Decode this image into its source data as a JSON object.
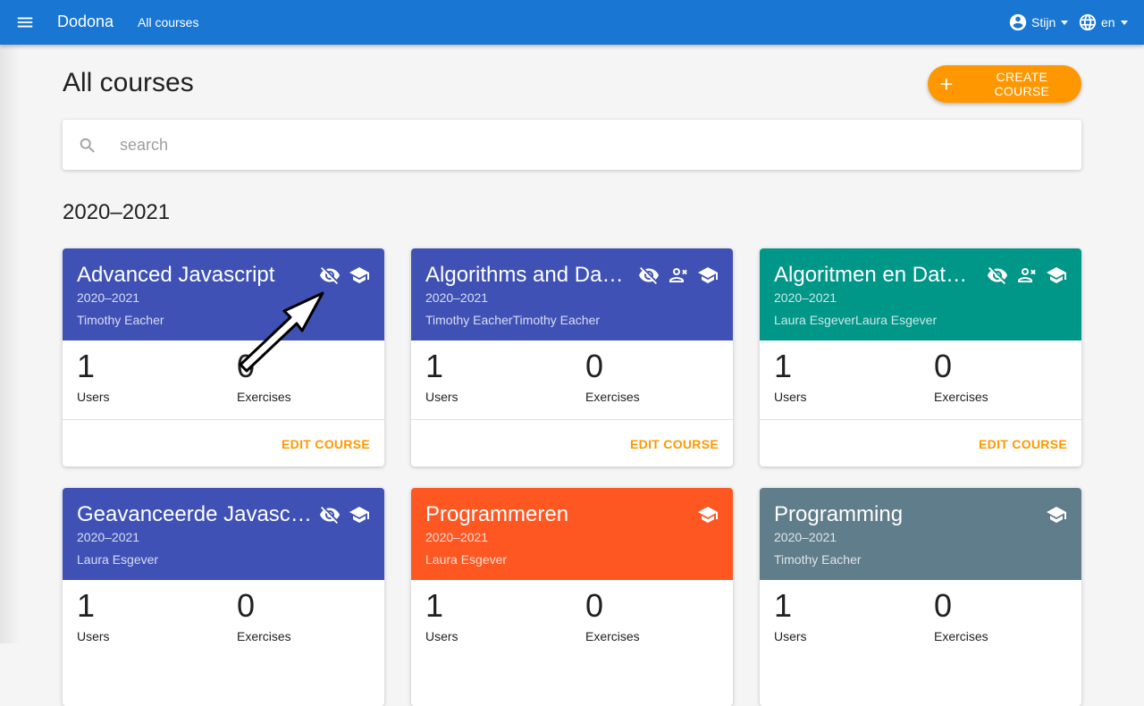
{
  "header": {
    "brand": "Dodona",
    "breadcrumb": "All courses",
    "user_name": "Stijn",
    "language": "en",
    "color": "#1976d2"
  },
  "page": {
    "title": "All courses",
    "create_button_label": "CREATE COURSE",
    "accent": "#ff9800"
  },
  "search": {
    "placeholder": "search",
    "value": ""
  },
  "year_group": {
    "heading": "2020–2021"
  },
  "courses": [
    {
      "title": "Advanced Javascript",
      "year": "2020–2021",
      "teacher": "Timothy Eacher",
      "color": "#3f51b5",
      "icons": [
        "visibility-off-icon",
        "school-icon"
      ],
      "users": "1",
      "users_label": "Users",
      "exercises": "0",
      "exercises_label": "Exercises",
      "action": "EDIT COURSE"
    },
    {
      "title": "Algorithms and Data …",
      "year": "2020–2021",
      "teacher": "Timothy EacherTimothy Eacher",
      "color": "#3f51b5",
      "icons": [
        "visibility-off-icon",
        "person-remove-icon",
        "school-icon"
      ],
      "users": "1",
      "users_label": "Users",
      "exercises": "0",
      "exercises_label": "Exercises",
      "action": "EDIT COURSE"
    },
    {
      "title": "Algoritmen en Datast…",
      "year": "2020–2021",
      "teacher": "Laura EsgeverLaura Esgever",
      "color": "#009688",
      "icons": [
        "visibility-off-icon",
        "person-remove-icon",
        "school-icon"
      ],
      "users": "1",
      "users_label": "Users",
      "exercises": "0",
      "exercises_label": "Exercises",
      "action": "EDIT COURSE"
    },
    {
      "title": "Geavanceerde Javascript",
      "year": "2020–2021",
      "teacher": "Laura Esgever",
      "color": "#3f51b5",
      "icons": [
        "visibility-off-icon",
        "school-icon"
      ],
      "users": "1",
      "users_label": "Users",
      "exercises": "0",
      "exercises_label": "Exercises"
    },
    {
      "title": "Programmeren",
      "year": "2020–2021",
      "teacher": "Laura Esgever",
      "color": "#ff5722",
      "icons": [
        "school-icon"
      ],
      "users": "1",
      "users_label": "Users",
      "exercises": "0",
      "exercises_label": "Exercises"
    },
    {
      "title": "Programming",
      "year": "2020–2021",
      "teacher": "Timothy Eacher",
      "color": "#607d8b",
      "icons": [
        "school-icon"
      ],
      "users": "1",
      "users_label": "Users",
      "exercises": "0",
      "exercises_label": "Exercises"
    }
  ]
}
